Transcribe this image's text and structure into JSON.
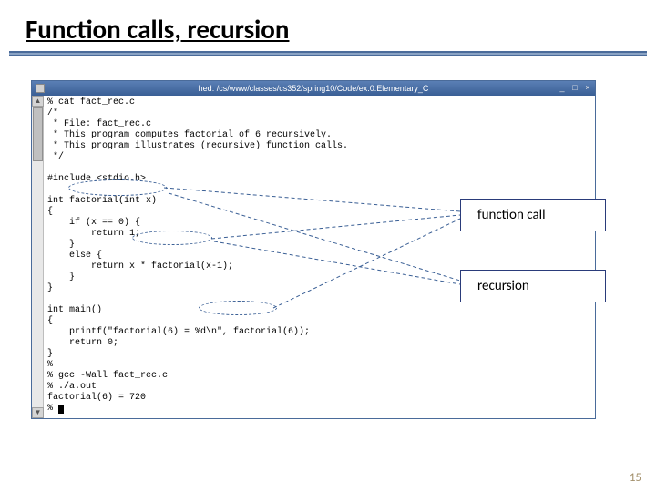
{
  "slide": {
    "title": "Function calls, recursion",
    "page_number": "15"
  },
  "window": {
    "title_prefix": "hed:",
    "title_path": "/cs/www/classes/cs352/spring10/Code/ex.0.Elementary_C",
    "buttons": {
      "min": "_",
      "max": "□",
      "close": "×"
    },
    "scroll_up": "▲",
    "scroll_down": "▼"
  },
  "code": {
    "l01": "% cat fact_rec.c",
    "l02": "/*",
    "l03": " * File: fact_rec.c",
    "l04": " * This program computes factorial of 6 recursively.",
    "l05": " * This program illustrates (recursive) function calls.",
    "l06": " */",
    "l07": "",
    "l08": "#include <stdio.h>",
    "l09": "",
    "l10": "int factorial(int x)",
    "l11": "{",
    "l12": "    if (x == 0) {",
    "l13": "        return 1;",
    "l14": "    }",
    "l15": "    else {",
    "l16": "        return x * factorial(x-1);",
    "l17": "    }",
    "l18": "}",
    "l19": "",
    "l20": "int main()",
    "l21": "{",
    "l22": "    printf(\"factorial(6) = %d\\n\", factorial(6));",
    "l23": "    return 0;",
    "l24": "}",
    "l25": "%",
    "l26": "% gcc -Wall fact_rec.c",
    "l27": "% ./a.out",
    "l28": "factorial(6) = 720",
    "l29": "% "
  },
  "annotations": {
    "function_call": "function call",
    "recursion": "recursion"
  }
}
